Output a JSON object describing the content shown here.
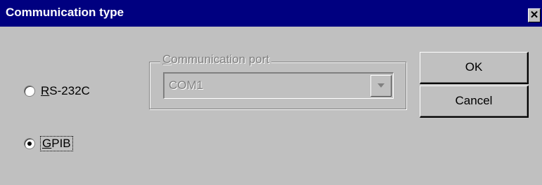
{
  "dialog": {
    "title": "Communication type",
    "close_glyph": "✕"
  },
  "radios": [
    {
      "prefix": "",
      "mnemonic": "R",
      "rest": "S-232C",
      "checked": false
    },
    {
      "prefix": "",
      "mnemonic": "G",
      "rest": "PIB",
      "checked": true
    }
  ],
  "port_group": {
    "legend_mnemonic": "C",
    "legend_rest": "ommunication port",
    "selected_value": "COM1",
    "disabled": true
  },
  "buttons": {
    "ok_label": "OK",
    "cancel_label": "Cancel"
  },
  "icons": {
    "close": "close-icon",
    "dropdown": "chevron-down-icon"
  },
  "colors": {
    "titlebar": "#000080",
    "face": "#c0c0c0",
    "disabled_text": "#808080"
  }
}
